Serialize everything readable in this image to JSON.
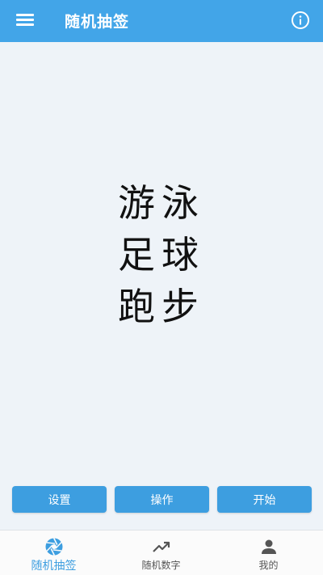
{
  "appbar": {
    "title": "随机抽签"
  },
  "draw": {
    "items": [
      "游泳",
      "足球",
      "跑步"
    ]
  },
  "actions": {
    "settings": "设置",
    "operate": "操作",
    "start": "开始"
  },
  "nav": {
    "items": [
      {
        "label": "随机抽签",
        "icon": "aperture-icon",
        "active": true
      },
      {
        "label": "随机数字",
        "icon": "trending-up-icon",
        "active": false
      },
      {
        "label": "我的",
        "icon": "person-icon",
        "active": false
      }
    ]
  },
  "colors": {
    "primary": "#42a5e8",
    "button": "#3d9ee0",
    "background": "#eef3f8",
    "inactive_icon": "#555555"
  }
}
